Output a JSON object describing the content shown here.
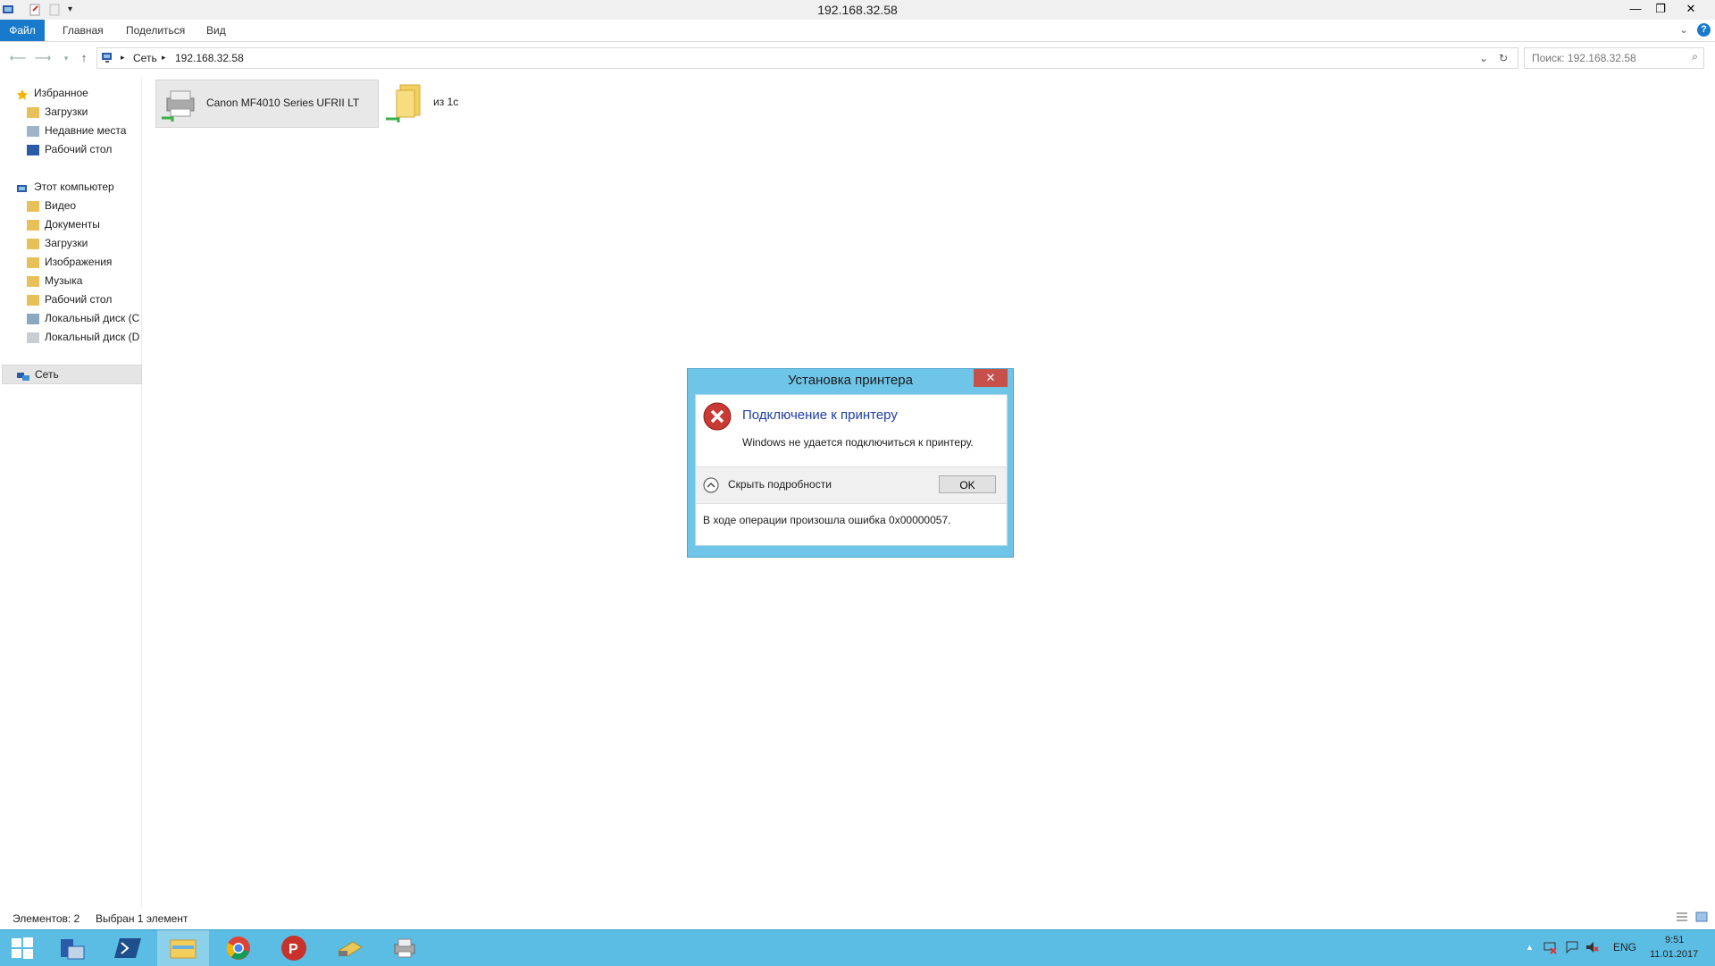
{
  "window": {
    "title": "192.168.32.58"
  },
  "ribbon": {
    "tabs": [
      "Файл",
      "Главная",
      "Поделиться",
      "Вид"
    ],
    "active_tab": "Файл"
  },
  "address": {
    "crumbs": [
      "Сеть",
      "192.168.32.58"
    ],
    "search_placeholder": "Поиск: 192.168.32.58"
  },
  "nav": {
    "favorites": {
      "label": "Избранное",
      "items": [
        "Загрузки",
        "Недавние места",
        "Рабочий стол"
      ]
    },
    "computer": {
      "label": "Этот компьютер",
      "items": [
        "Видео",
        "Документы",
        "Загрузки",
        "Изображения",
        "Музыка",
        "Рабочий стол",
        "Локальный диск (C",
        "Локальный диск (D"
      ]
    },
    "network": {
      "label": "Сеть"
    }
  },
  "content": {
    "items": [
      "Canon MF4010 Series UFRII LT",
      "из 1с"
    ]
  },
  "status": {
    "count": "Элементов: 2",
    "selection": "Выбран 1 элемент"
  },
  "dialog": {
    "title": "Установка принтера",
    "heading": "Подключение к принтеру",
    "message": "Windows не удается подключиться к принтеру.",
    "toggle": "Скрыть подробности",
    "ok": "OK",
    "detail": "В ходе операции произошла ошибка 0x00000057."
  },
  "tray": {
    "lang": "ENG",
    "time": "9:51",
    "date": "11.01.2017"
  },
  "colors": {
    "accent": "#1979ca",
    "taskbar": "#5bbde3",
    "dialog_frame": "#6fc5e8",
    "error_red": "#c7504b"
  }
}
